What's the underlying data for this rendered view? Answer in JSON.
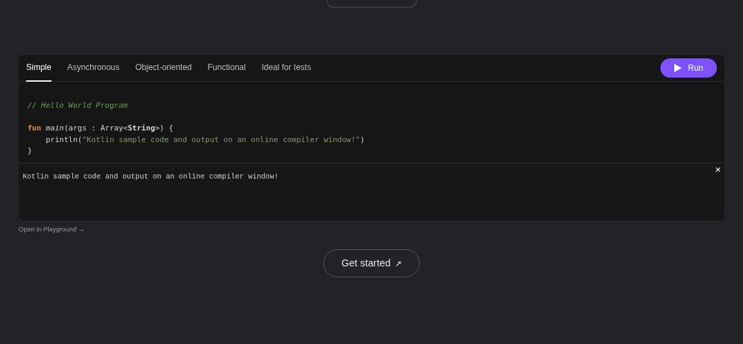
{
  "tabs": [
    {
      "label": "Simple",
      "selected": true
    },
    {
      "label": "Asynchronous",
      "selected": false
    },
    {
      "label": "Object-oriented",
      "selected": false
    },
    {
      "label": "Functional",
      "selected": false
    },
    {
      "label": "Ideal for tests",
      "selected": false
    }
  ],
  "run_button": {
    "label": "Run"
  },
  "code": {
    "lines": [
      {
        "kind": "code",
        "tokens": [
          {
            "text": "// Hello World Program",
            "kind": "comment"
          }
        ]
      },
      {
        "kind": "blank"
      },
      {
        "kind": "code",
        "tokens": [
          {
            "text": "fun",
            "kind": "keyword"
          },
          {
            "text": " main",
            "kind": "function"
          },
          {
            "text": "(args : Array<",
            "kind": "plain"
          },
          {
            "text": "String",
            "kind": "type"
          },
          {
            "text": ">) {",
            "kind": "plain"
          }
        ]
      },
      {
        "kind": "code",
        "tokens": [
          {
            "text": "    println(",
            "kind": "plain"
          },
          {
            "text": "\"Kotlin sample code and output on an online compiler window!\"",
            "kind": "string"
          },
          {
            "text": ")",
            "kind": "plain"
          }
        ]
      },
      {
        "kind": "code",
        "tokens": [
          {
            "text": "}",
            "kind": "plain"
          }
        ]
      }
    ]
  },
  "output": {
    "text": "Kotlin sample code and output on an online compiler window!",
    "close": "×"
  },
  "playground_link": "Open in Playground →",
  "get_started": {
    "label": "Get started",
    "arrow": "↗"
  }
}
